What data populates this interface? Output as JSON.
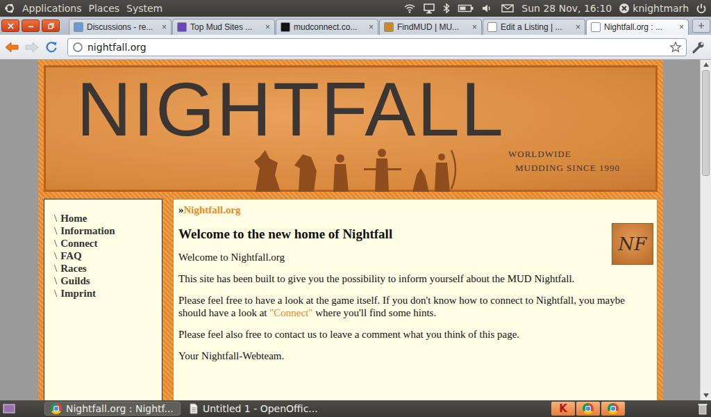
{
  "top_panel": {
    "menus": [
      "Applications",
      "Places",
      "System"
    ],
    "clock": "Sun 28 Nov, 16:10",
    "user": "knightmarh"
  },
  "browser": {
    "tabs": [
      {
        "label": "Discussions - re...",
        "selected": false
      },
      {
        "label": "Top Mud Sites ...",
        "selected": false
      },
      {
        "label": "mudconnect.co...",
        "selected": false
      },
      {
        "label": "FindMUD | MU...",
        "selected": false
      },
      {
        "label": "Edit a Listing | ...",
        "selected": false
      },
      {
        "label": "Nightfall.org : ...",
        "selected": true
      }
    ],
    "tab_close": "×",
    "address": "nightfall.org"
  },
  "page": {
    "logo": "NIGHTFALL",
    "tagline": [
      "WORLDWIDE",
      "MUDDING SINCE 1990"
    ],
    "nav_marker": "\\",
    "nav": [
      {
        "label": "Home"
      },
      {
        "label": "Information"
      },
      {
        "label": "Connect"
      },
      {
        "label": "FAQ"
      },
      {
        "label": "Races"
      },
      {
        "label": "Guilds"
      },
      {
        "label": "Imprint"
      }
    ],
    "breadcrumb_marker": "»",
    "breadcrumb": "Nightfall.org",
    "badge": "NF",
    "heading": "Welcome to the new home of Nightfall",
    "paragraphs": [
      [
        {
          "text": "Welcome to Nightfall.org",
          "link": false
        }
      ],
      [
        {
          "text": "This site has been built to give you the possibility to inform yourself about the MUD Nightfall.",
          "link": false
        }
      ],
      [
        {
          "text": "Please feel free to have a look at the game itself. If you don't know how to connect to Nightfall, you maybe should have a look at ",
          "link": false
        },
        {
          "text": "\"Connect\"",
          "link": true
        },
        {
          "text": " where you'll find some hints.",
          "link": false
        }
      ],
      [
        {
          "text": "Please feel also free to contact us to leave a comment what you think of this page.",
          "link": false
        }
      ],
      [
        {
          "text": "Your Nightfall-Webteam.",
          "link": false
        }
      ]
    ]
  },
  "taskbar": {
    "windows": [
      {
        "label": "Nightfall.org : Nightf...",
        "selected": true
      },
      {
        "label": "Untitled 1 - OpenOffic...",
        "selected": false
      }
    ],
    "tray": [
      {
        "label": "K"
      }
    ]
  }
}
